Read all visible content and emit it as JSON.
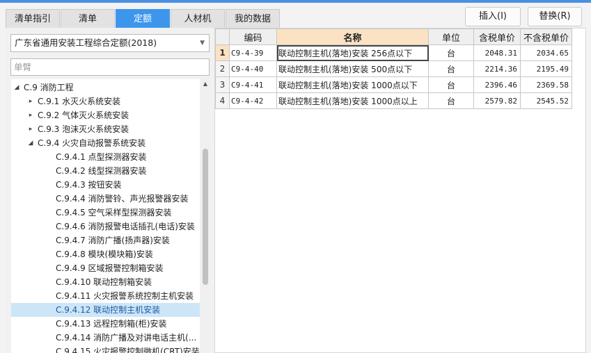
{
  "tabs": [
    "清单指引",
    "清单",
    "定额",
    "人材机",
    "我的数据"
  ],
  "active_tab": "定额",
  "buttons": {
    "insert": "插入(I)",
    "replace": "替换(R)"
  },
  "quota_select": {
    "value": "广东省通用安装工程综合定额(2018)"
  },
  "search": {
    "placeholder": "单臂"
  },
  "tree": [
    {
      "label": "C.9 消防工程",
      "arrow": "◢"
    },
    {
      "label": "C.9.1 水灭火系统安装",
      "arrow": "▸"
    },
    {
      "label": "C.9.2 气体灭火系统安装",
      "arrow": "▸"
    },
    {
      "label": "C.9.3 泡沫灭火系统安装",
      "arrow": "▸"
    },
    {
      "label": "C.9.4 火灾自动报警系统安装",
      "arrow": "◢"
    },
    {
      "label": "C.9.4.1 点型探测器安装",
      "arrow": ""
    },
    {
      "label": "C.9.4.2 线型探测器安装",
      "arrow": ""
    },
    {
      "label": "C.9.4.3 按钮安装",
      "arrow": ""
    },
    {
      "label": "C.9.4.4 消防警铃、声光报警器安装",
      "arrow": ""
    },
    {
      "label": "C.9.4.5 空气采样型探测器安装",
      "arrow": ""
    },
    {
      "label": "C.9.4.6 消防报警电话插孔(电话)安装",
      "arrow": ""
    },
    {
      "label": "C.9.4.7 消防广播(扬声器)安装",
      "arrow": ""
    },
    {
      "label": "C.9.4.8 模块(模块箱)安装",
      "arrow": ""
    },
    {
      "label": "C.9.4.9 区域报警控制箱安装",
      "arrow": ""
    },
    {
      "label": "C.9.4.10 联动控制箱安装",
      "arrow": ""
    },
    {
      "label": "C.9.4.11 火灾报警系统控制主机安装",
      "arrow": ""
    },
    {
      "label": "C.9.4.12 联动控制主机安装",
      "arrow": ""
    },
    {
      "label": "C.9.4.13 远程控制箱(柜)安装",
      "arrow": ""
    },
    {
      "label": "C.9.4.14 消防广播及对讲电话主机(...",
      "arrow": ""
    },
    {
      "label": "C.9.4.15 火灾报警控制微机(CRT)安装",
      "arrow": ""
    }
  ],
  "selected_tree_item": "C.9.4.12 联动控制主机安装",
  "table": {
    "headers": [
      "",
      "编码",
      "名称",
      "单位",
      "含税单价",
      "不含税单价"
    ],
    "rows": [
      {
        "no": "1",
        "code": "C9-4-39",
        "name": "联动控制主机(落地)安装 256点以下",
        "unit": "台",
        "price_tax": "2048.31",
        "price_notax": "2034.65"
      },
      {
        "no": "2",
        "code": "C9-4-40",
        "name": "联动控制主机(落地)安装 500点以下",
        "unit": "台",
        "price_tax": "2214.36",
        "price_notax": "2195.49"
      },
      {
        "no": "3",
        "code": "C9-4-41",
        "name": "联动控制主机(落地)安装 1000点以下",
        "unit": "台",
        "price_tax": "2396.46",
        "price_notax": "2369.58"
      },
      {
        "no": "4",
        "code": "C9-4-42",
        "name": "联动控制主机(落地)安装 1000点以上",
        "unit": "台",
        "price_tax": "2579.82",
        "price_notax": "2545.52"
      }
    ]
  },
  "colors": {
    "accent": "#3e96ec",
    "selection": "#cde6f7",
    "header_highlight": "#fbe2c3"
  }
}
